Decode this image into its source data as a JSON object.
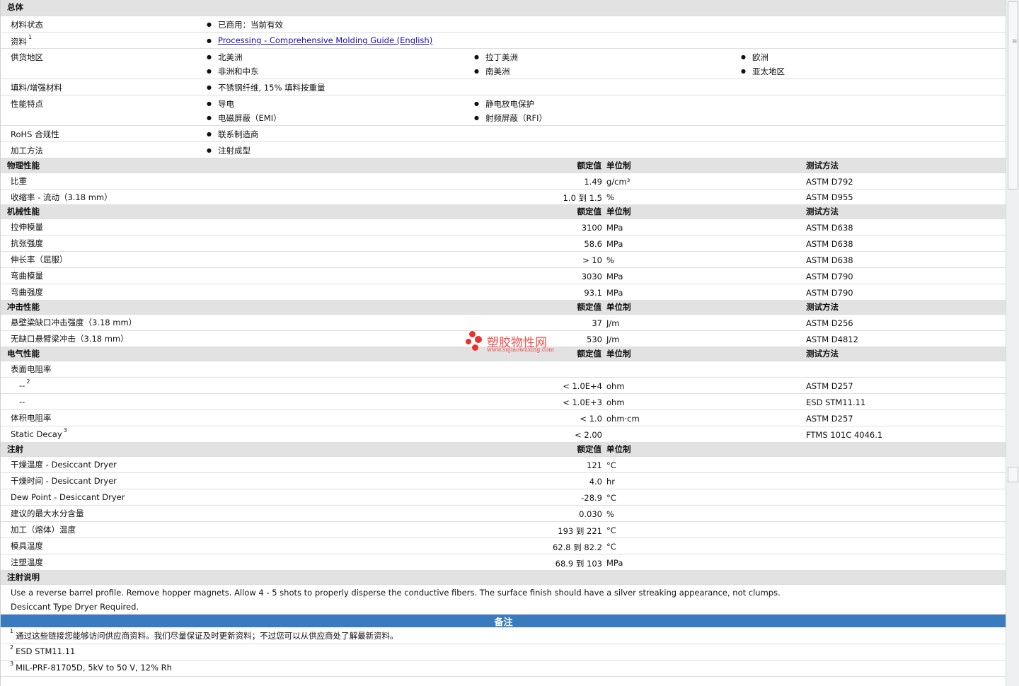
{
  "general": {
    "title": "总体",
    "rows": [
      {
        "label": "材料状态",
        "items": [
          "已商用：当前有效"
        ]
      },
      {
        "label": "资料",
        "sup": "1",
        "link": "Processing - Comprehensive Molding Guide (English)"
      },
      {
        "label": "供货地区",
        "items": [
          "北美洲",
          "拉丁美洲",
          "欧洲",
          "非洲和中东",
          "南美洲",
          "亚太地区"
        ]
      },
      {
        "label": "填料/增强材料",
        "items": [
          "不锈钢纤维, 15% 填料按重量"
        ]
      },
      {
        "label": "性能特点",
        "items": [
          "导电",
          "静电放电保护",
          "电磁屏蔽（EMI）",
          "射频屏蔽（RFI）"
        ]
      },
      {
        "label": "RoHS 合规性",
        "items": [
          "联系制造商"
        ]
      },
      {
        "label": "加工方法",
        "items": [
          "注射成型"
        ]
      }
    ]
  },
  "columns": {
    "rated": "额定值",
    "unit": "单位制",
    "method": "测试方法"
  },
  "physical": {
    "title": "物理性能",
    "rows": [
      {
        "label": "比重",
        "value": "1.49",
        "unit": "g/cm³",
        "method": "ASTM D792"
      },
      {
        "label": "收缩率  - 流动（3.18 mm）",
        "value": "1.0 到  1.5",
        "unit": "%",
        "method": "ASTM D955"
      }
    ]
  },
  "mechanical": {
    "title": "机械性能",
    "rows": [
      {
        "label": "拉伸模量",
        "value": "3100",
        "unit": "MPa",
        "method": "ASTM D638"
      },
      {
        "label": "抗张强度",
        "value": "58.6",
        "unit": "MPa",
        "method": "ASTM D638"
      },
      {
        "label": "伸长率（屈服）",
        "value": "> 10",
        "unit": "%",
        "method": "ASTM D638"
      },
      {
        "label": "弯曲模量",
        "value": "3030",
        "unit": "MPa",
        "method": "ASTM D790"
      },
      {
        "label": "弯曲强度",
        "value": "93.1",
        "unit": "MPa",
        "method": "ASTM D790"
      }
    ]
  },
  "impact": {
    "title": "冲击性能",
    "rows": [
      {
        "label": "悬壁梁缺口冲击强度（3.18 mm）",
        "value": "37",
        "unit": "J/m",
        "method": "ASTM D256"
      },
      {
        "label": "无缺口悬臂梁冲击（3.18 mm）",
        "value": "530",
        "unit": "J/m",
        "method": "ASTM D4812"
      }
    ]
  },
  "electrical": {
    "title": "电气性能",
    "rows": [
      {
        "label": "表面电阻率",
        "value": "",
        "unit": "",
        "method": ""
      },
      {
        "label": "--",
        "sup": "2",
        "value": "< 1.0E+4",
        "unit": "ohm",
        "method": "ASTM D257"
      },
      {
        "label": "--",
        "value": "< 1.0E+3",
        "unit": "ohm",
        "method": "ESD STM11.11"
      },
      {
        "label": "体积电阻率",
        "value": "< 1.0",
        "unit": "ohm·cm",
        "method": "ASTM D257"
      },
      {
        "label": "Static Decay",
        "sup": "3",
        "value": "< 2.00",
        "unit": "",
        "method": "FTMS 101C 4046.1"
      }
    ]
  },
  "injection": {
    "title": "注射",
    "rows": [
      {
        "label": "干燥温度  - Desiccant Dryer",
        "value": "121",
        "unit": "°C"
      },
      {
        "label": "干燥时间  - Desiccant Dryer",
        "value": "4.0",
        "unit": "hr"
      },
      {
        "label": "Dew Point - Desiccant Dryer",
        "value": "-28.9",
        "unit": "°C"
      },
      {
        "label": "建议的最大水分含量",
        "value": "0.030",
        "unit": "%"
      },
      {
        "label": "加工（熔体）温度",
        "value": "193 到  221",
        "unit": "°C"
      },
      {
        "label": "模具温度",
        "value": "62.8 到  82.2",
        "unit": "°C"
      },
      {
        "label": "注塑温度",
        "value": "68.9 到  103",
        "unit": "MPa"
      }
    ]
  },
  "injection_notes": {
    "title": "注射说明",
    "lines": [
      "Use a reverse barrel profile. Remove hopper magnets. Allow 4 - 5 shots to properly disperse the conductive fibers. The surface finish should have a silver streaking appearance, not clumps.",
      "Desiccant Type Dryer Required."
    ]
  },
  "remarks": {
    "title": "备注",
    "notes": [
      {
        "num": "1",
        "text": "通过这些链接您能够访问供应商资料。我们尽量保证及时更新资料；不过您可以从供应商处了解最新资料。"
      },
      {
        "num": "2",
        "text": "ESD STM11.11"
      },
      {
        "num": "3",
        "text": "MIL-PRF-81705D, 5kV to 50 V, 12% Rh"
      }
    ]
  },
  "watermark": {
    "name": "塑胶物性网",
    "url": "www.sujiaowuxing.com",
    "color": "#e8312f"
  },
  "colors": {
    "section_bg": "#e2e2e2",
    "banner_bg": "#3a7bbf",
    "link": "#1a0dab"
  }
}
